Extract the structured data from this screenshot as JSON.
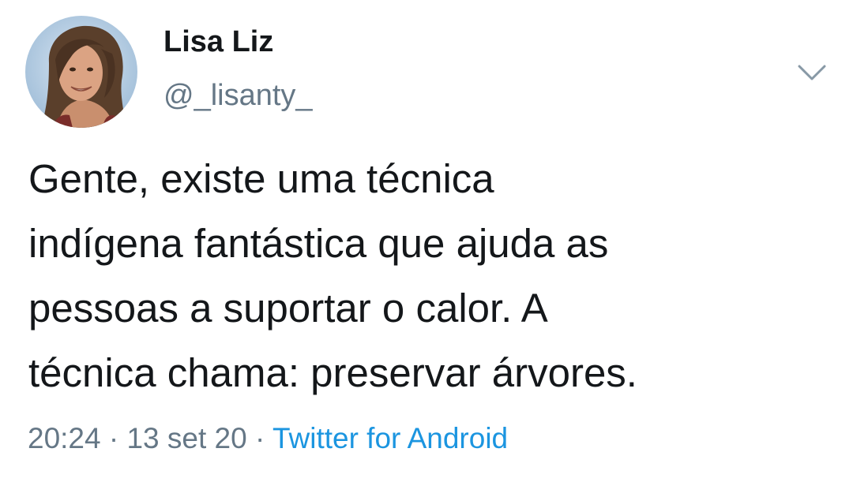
{
  "tweet": {
    "display_name": "Lisa Liz",
    "handle": "@_lisanty_",
    "text": "Gente, existe uma técnica\nindígena fantástica que ajuda as\npessoas a suportar o calor.  A\ntécnica chama: preservar árvores.",
    "time": "20:24",
    "separator": " · ",
    "date": "13 set 20",
    "source": "Twitter for Android"
  },
  "icons": {
    "avatar": "profile-photo",
    "menu": "chevron-down-icon"
  },
  "colors": {
    "name_text": "#14171a",
    "secondary_text": "#657786",
    "link": "#1b95e0",
    "chevron": "#8899a6",
    "avatar_bg": "#b7cfe6"
  }
}
